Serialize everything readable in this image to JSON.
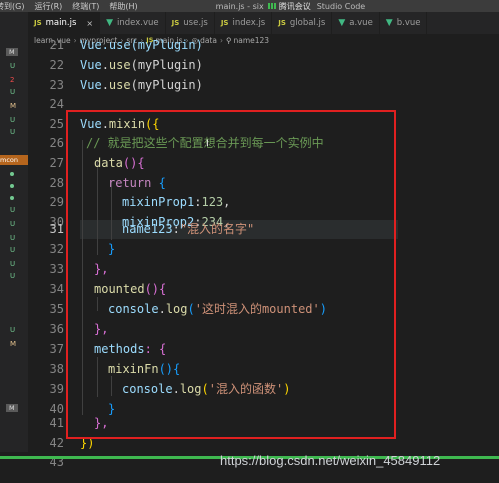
{
  "menubar": {
    "items": [
      "转到(G)",
      "运行(R)",
      "终端(T)",
      "帮助(H)"
    ],
    "title_prefix": "main.js - six",
    "meeting": "腾讯会议",
    "title_suffix": "Studio Code"
  },
  "tabs": [
    {
      "icon": "JS",
      "label": "main.js",
      "active": true,
      "trail": "×"
    },
    {
      "icon": "VUE",
      "label": "index.vue",
      "active": false,
      "trail": ""
    },
    {
      "icon": "JS",
      "label": "use.js",
      "active": false,
      "trail": ""
    },
    {
      "icon": "JS",
      "label": "index.js",
      "active": false,
      "trail": ""
    },
    {
      "icon": "JS",
      "label": "global.js",
      "active": false,
      "trail": ""
    },
    {
      "icon": "VUE",
      "label": "a.vue",
      "active": false,
      "trail": ""
    },
    {
      "icon": "VUE",
      "label": "b.vue",
      "active": false,
      "trail": ""
    }
  ],
  "breadcrumb": [
    "learn_vue",
    "myproject",
    "src",
    "main.js",
    "data",
    "name123"
  ],
  "sidebar": {
    "label_mcon": "mcon",
    "badges": [
      "M",
      "U",
      "2",
      "U",
      "M",
      "U",
      "U",
      "U",
      "U",
      "U",
      "U",
      "U",
      "M",
      "M"
    ]
  },
  "editor": {
    "line_numbers": [
      "21",
      "22",
      "23",
      "24",
      "25",
      "26",
      "27",
      "28",
      "29",
      "30",
      "31",
      "32",
      "33",
      "34",
      "35",
      "36",
      "37",
      "38",
      "39",
      "40",
      "41",
      "42",
      "43"
    ],
    "code": {
      "l21": "Vue.use(myPlugin)",
      "l22_obj": "Vue",
      "l22_dot": ".",
      "l22_fn": "use",
      "l22_arg": "(myPlugin)",
      "l23_obj": "Vue",
      "l23_dot": ".",
      "l23_fn": "use",
      "l23_arg": "(myPlugin)",
      "l25_obj": "Vue",
      "l25_dot": ".",
      "l25_fn": "mixin",
      "l25_open": "({",
      "l26_comment": "// 就是把这些个配置想合并到每一个实例中",
      "l27_fn": "data",
      "l27_rest": "(){",
      "l28_kw": "return",
      "l28_rest": " {",
      "l29_key": "mixinProp1",
      "l29_colon": ":",
      "l29_val": "123",
      "l29_end": ",",
      "l30_key": "mixinProp2",
      "l30_colon": ":",
      "l30_val": "234",
      "l30_end": ",",
      "l31_key": "name123",
      "l31_colon": ":",
      "l31_val": "\"混入的名字\"",
      "l32": "}",
      "l33": "},",
      "l34_fn": "mounted",
      "l34_rest": "(){",
      "l35_obj": "console",
      "l35_dot": ".",
      "l35_fn": "log",
      "l35_open": "(",
      "l35_str": "'这时混入的mounted'",
      "l35_close": ")",
      "l36": "},",
      "l37_key": "methods",
      "l37_rest": ": {",
      "l38_fn": "mixinFn",
      "l38_rest": "(){",
      "l39_obj": "console",
      "l39_dot": ".",
      "l39_fn": "log",
      "l39_open": "(",
      "l39_str": "'混入的函数'",
      "l39_close": ")",
      "l40": "}",
      "l41": "},",
      "l42": "})"
    },
    "cursor_char": "I"
  },
  "watermark": "https://blog.csdn.net/weixin_45849112",
  "colors": {
    "background": "#1e1e1e",
    "selection_box": "#e02020",
    "status_green": "#3fb950"
  }
}
